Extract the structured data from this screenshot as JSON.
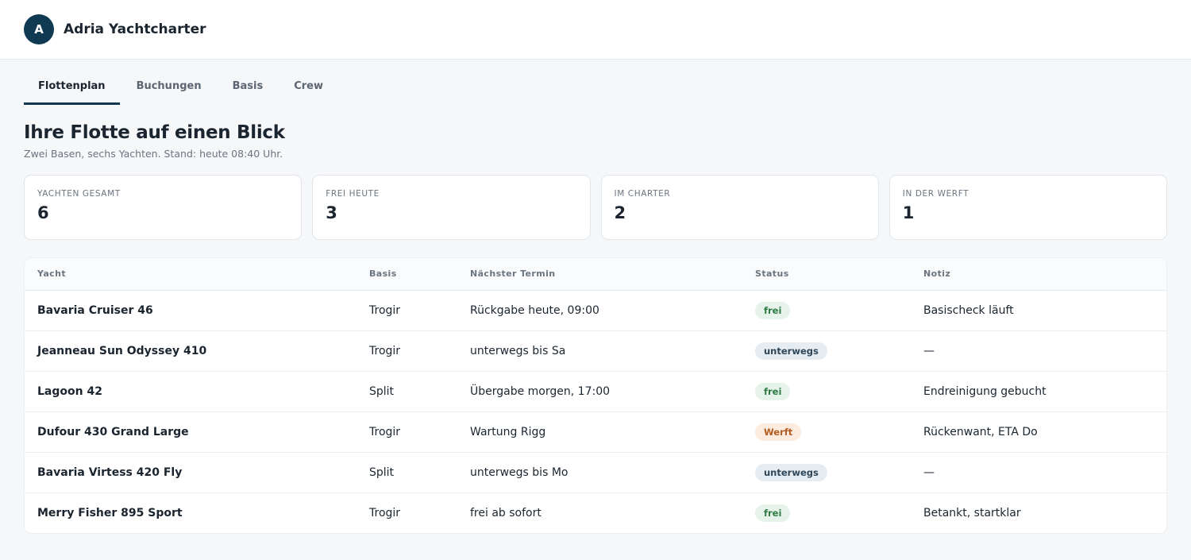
{
  "header": {
    "avatar_letter": "A",
    "brand": "Adria Yachtcharter"
  },
  "tabs": [
    {
      "label": "Flottenplan",
      "active": true
    },
    {
      "label": "Buchungen",
      "active": false
    },
    {
      "label": "Basis",
      "active": false
    },
    {
      "label": "Crew",
      "active": false
    }
  ],
  "page": {
    "title": "Ihre Flotte auf einen Blick",
    "subtitle": "Zwei Basen, sechs Yachten. Stand: heute 08:40 Uhr."
  },
  "stats": [
    {
      "label": "YACHTEN GESAMT",
      "value": "6"
    },
    {
      "label": "FREI HEUTE",
      "value": "3"
    },
    {
      "label": "IM CHARTER",
      "value": "2"
    },
    {
      "label": "IN DER WERFT",
      "value": "1"
    }
  ],
  "table": {
    "columns": [
      "Yacht",
      "Basis",
      "Nächster Termin",
      "Status",
      "Notiz"
    ],
    "rows": [
      {
        "yacht": "Bavaria Cruiser 46",
        "basis": "Trogir",
        "termin": "Rückgabe heute, 09:00",
        "status": "frei",
        "status_type": "frei",
        "notiz": "Basischeck läuft"
      },
      {
        "yacht": "Jeanneau Sun Odyssey 410",
        "basis": "Trogir",
        "termin": "unterwegs bis Sa",
        "status": "unterwegs",
        "status_type": "unterwegs",
        "notiz": "—"
      },
      {
        "yacht": "Lagoon 42",
        "basis": "Split",
        "termin": "Übergabe morgen, 17:00",
        "status": "frei",
        "status_type": "frei",
        "notiz": "Endreinigung gebucht"
      },
      {
        "yacht": "Dufour 430 Grand Large",
        "basis": "Trogir",
        "termin": "Wartung Rigg",
        "status": "Werft",
        "status_type": "werft",
        "notiz": "Rückenwant, ETA Do"
      },
      {
        "yacht": "Bavaria Virtess 420 Fly",
        "basis": "Split",
        "termin": "unterwegs bis Mo",
        "status": "unterwegs",
        "status_type": "unterwegs",
        "notiz": "—"
      },
      {
        "yacht": "Merry Fisher 895 Sport",
        "basis": "Trogir",
        "termin": "frei ab sofort",
        "status": "frei",
        "status_type": "frei",
        "notiz": "Betankt, startklar"
      }
    ]
  },
  "colors": {
    "accent": "#0f3a52",
    "status_frei": "#2d7a45",
    "status_unterwegs": "#2f4658",
    "status_werft": "#b35b1f"
  }
}
